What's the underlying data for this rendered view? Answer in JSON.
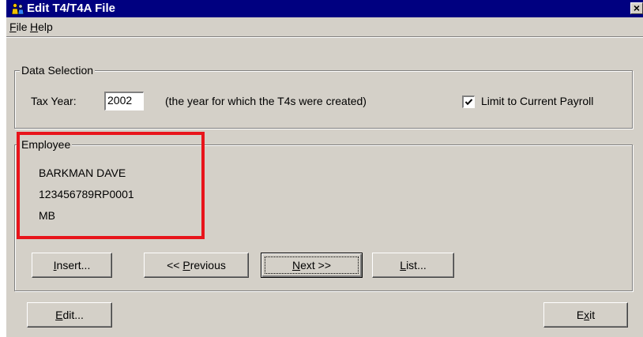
{
  "window": {
    "title": "Edit T4/T4A File",
    "app_icon": "people-icon",
    "close_label": "×"
  },
  "menu": {
    "items": [
      {
        "label": "File"
      },
      {
        "label": "Help"
      }
    ]
  },
  "data_selection": {
    "group_label": "Data Selection",
    "tax_year_label": "Tax Year:",
    "tax_year_value": "2002",
    "tax_year_note": "(the year for which the T4s were created)",
    "limit_label": "Limit to Current Payroll",
    "limit_checked": true
  },
  "employee": {
    "group_label": "Employee",
    "name": "BARKMAN DAVE",
    "account": "123456789RP0001",
    "province": "MB"
  },
  "buttons": {
    "insert": {
      "pre": "",
      "ul": "I",
      "post": "nsert..."
    },
    "previous": {
      "pre": "<< ",
      "ul": "P",
      "post": "revious"
    },
    "next": {
      "pre": "",
      "ul": "N",
      "post": "ext >>"
    },
    "list": {
      "pre": "",
      "ul": "L",
      "post": "ist..."
    },
    "edit": {
      "pre": "",
      "ul": "E",
      "post": "dit..."
    },
    "exit": {
      "pre": "E",
      "ul": "x",
      "post": "it"
    }
  },
  "colors": {
    "window_bg": "#d4d0c8",
    "titlebar_bg": "#000080",
    "highlight_border": "#e8141b"
  }
}
